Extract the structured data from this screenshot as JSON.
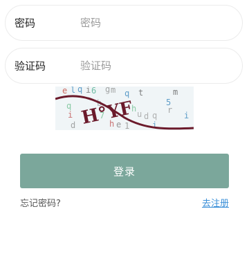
{
  "form": {
    "password": {
      "label": "密码",
      "placeholder": "密码"
    },
    "captcha": {
      "label": "验证码",
      "placeholder": "验证码",
      "image_text": "H°YF"
    },
    "login_button": "登录",
    "forgot_password": "忘记密码?",
    "register": "去注册"
  },
  "colors": {
    "accent": "#7ba79b",
    "link": "#3a8fd8",
    "captcha_text": "#6b1a2b",
    "border": "#ebebeb"
  }
}
